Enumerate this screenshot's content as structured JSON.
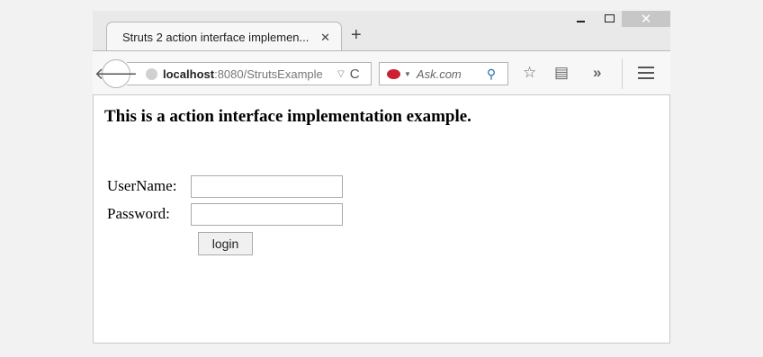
{
  "window": {
    "controls": {
      "minimize": "",
      "maximize": "",
      "close": "✕"
    }
  },
  "tab": {
    "title": "Struts 2 action interface implemen...",
    "close": "✕",
    "new_tab": "+"
  },
  "toolbar": {
    "back": "🡐",
    "url_host": "localhost",
    "url_path": ":8080/StrutsExample",
    "url_dropdown": "▽",
    "reload": "C",
    "search_placeholder": "Ask.com",
    "search_dropdown": "▼",
    "search_icon": "⚲",
    "bookmark_icon": "☆",
    "reader_icon": "▤",
    "overflow_icon": "»"
  },
  "page": {
    "heading": "This is a action interface implementation example.",
    "username_label": "UserName:",
    "password_label": "Password:",
    "username_value": "",
    "password_value": "",
    "login_label": "login"
  },
  "icons": {
    "back": "back-arrow-icon",
    "globe": "globe-icon",
    "reload": "reload-icon",
    "search_engine": "ask-logo-icon",
    "search": "magnifier-icon",
    "bookmark": "star-icon",
    "reader": "reading-list-icon",
    "overflow": "chevron-double-right-icon",
    "menu": "hamburger-menu-icon"
  },
  "colors": {
    "ask_brand": "#cc1f2f",
    "search_icon": "#2a6fb3",
    "chrome_bg": "#e9e9e9"
  }
}
